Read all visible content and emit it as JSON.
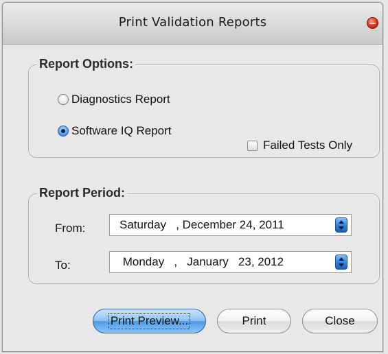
{
  "window": {
    "title": "Print Validation Reports"
  },
  "report_options": {
    "legend": "Report Options:",
    "diagnostics_label": "Diagnostics Report",
    "software_iq_label": "Software IQ Report",
    "selected": "Software IQ Report",
    "failed_tests_label": "Failed Tests Only",
    "failed_tests_checked": false
  },
  "report_period": {
    "legend": "Report Period:",
    "from_label": "From:",
    "from_value": "Saturday   , December 24, 2011",
    "to_label": "To:",
    "to_value": " Monday   ,   January   23, 2012"
  },
  "buttons": {
    "print_preview": "Print Preview...",
    "print": "Print",
    "close": "Close"
  },
  "colors": {
    "accent": "#4f9ae6",
    "close_button": "#e23b2a"
  },
  "icons": [
    "close-icon",
    "spinner-up-down-icon"
  ]
}
